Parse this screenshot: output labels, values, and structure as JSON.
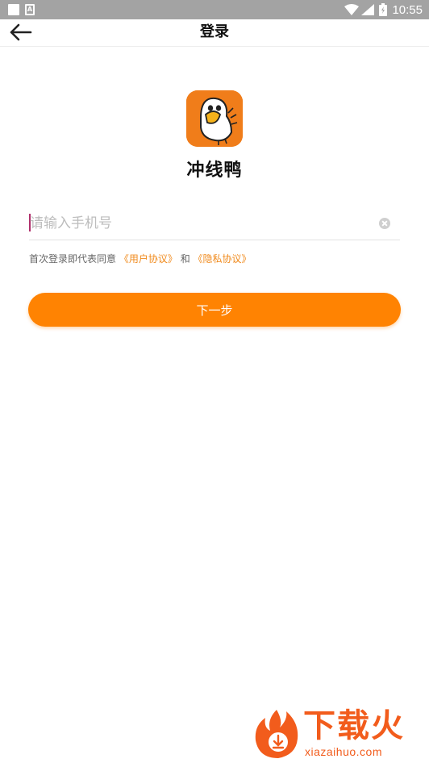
{
  "status_bar": {
    "time": "10:55",
    "icons": [
      "notification-square-icon",
      "a-icon",
      "wifi-icon",
      "signal-icon",
      "battery-icon"
    ]
  },
  "header": {
    "title": "登录",
    "back_icon": "back-arrow-icon"
  },
  "app": {
    "name": "冲线鸭",
    "logo_icon": "duck-logo-icon",
    "logo_color": "#f07d1a"
  },
  "phone_input": {
    "placeholder": "请输入手机号",
    "value": "",
    "clear_icon": "clear-icon"
  },
  "agreement": {
    "prefix": "首次登录即代表同意",
    "user_agreement": "《用户协议》",
    "and": "和",
    "privacy_agreement": "《隐私协议》"
  },
  "next_button": {
    "label": "下一步",
    "color": "#ff8302"
  },
  "watermark": {
    "text": "下载火",
    "url": "xiazaihuo.com",
    "color": "#f25c1c"
  }
}
